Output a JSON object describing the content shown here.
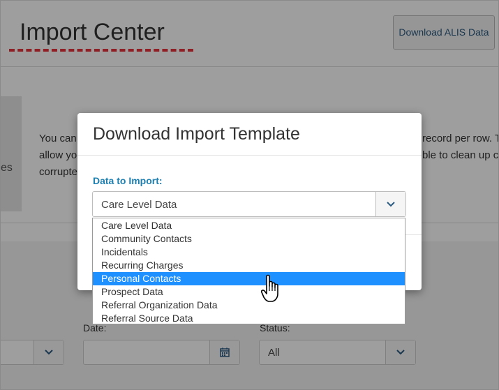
{
  "page": {
    "title": "Import Center",
    "download_button": "Download ALIS Data",
    "left_panel_text": "es",
    "description_left": [
      "You can",
      "allow yo",
      "corrupte"
    ],
    "description_right": [
      "record per row. T",
      "ble to clean up c"
    ],
    "filters": {
      "date_label": "Date:",
      "status_label": "Status:",
      "status_value": "All"
    }
  },
  "modal": {
    "title": "Download Import Template",
    "field_label": "Data to Import:",
    "selected_value": "Care Level Data",
    "options": [
      "Care Level Data",
      "Community Contacts",
      "Incidentals",
      "Recurring Charges",
      "Personal Contacts",
      "Prospect Data",
      "Referral Organization Data",
      "Referral Source Data"
    ],
    "highlighted_option": "Personal Contacts"
  },
  "colors": {
    "accent": "#1c7fb0",
    "highlight": "#1e90ff",
    "annotation": "#e8323c"
  }
}
